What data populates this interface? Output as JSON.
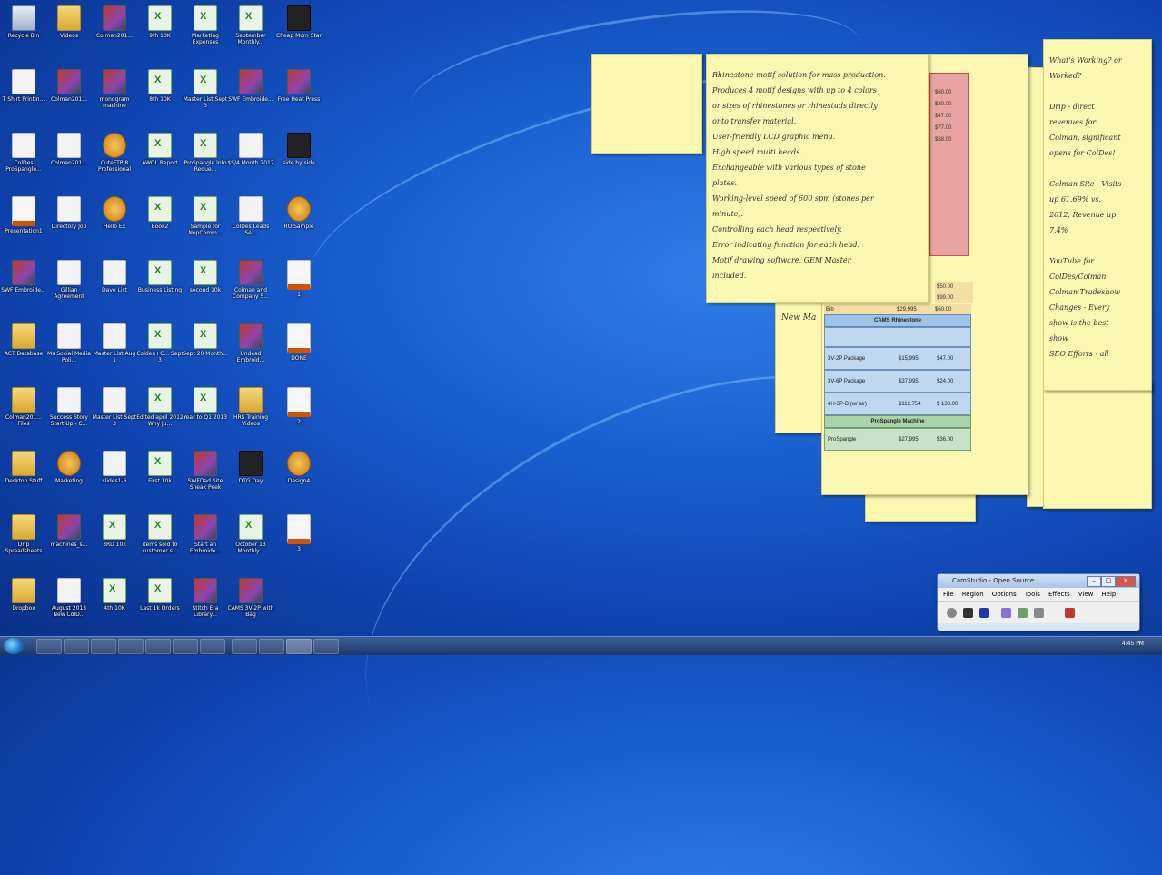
{
  "desktop_icons": [
    {
      "label": "Recycle Bin",
      "icon": "recycle-bin-icon"
    },
    {
      "label": "Videos",
      "icon": "folder-icon"
    },
    {
      "label": "Colman201...",
      "icon": "image-icon"
    },
    {
      "label": "9th 10K",
      "icon": "spreadsheet-icon"
    },
    {
      "label": "Marketing Expenses",
      "icon": "spreadsheet-icon"
    },
    {
      "label": "September Monthly...",
      "icon": "spreadsheet-icon"
    },
    {
      "label": "Cheap Mom Star",
      "icon": "video-icon"
    },
    {
      "label": "T Shirt Printin...",
      "icon": "document-icon"
    },
    {
      "label": "Colman201...",
      "icon": "image-icon"
    },
    {
      "label": "monogram machine",
      "icon": "image-icon"
    },
    {
      "label": "8th 10K",
      "icon": "spreadsheet-icon"
    },
    {
      "label": "Master List Sept 3",
      "icon": "spreadsheet-icon"
    },
    {
      "label": "SWF Embroide...",
      "icon": "image-icon"
    },
    {
      "label": "Free Heat Press",
      "icon": "image-icon"
    },
    {
      "label": "ColDes ProSpangle...",
      "icon": "document-icon"
    },
    {
      "label": "Colman201...",
      "icon": "document-icon"
    },
    {
      "label": "CuteFTP 8 Professional",
      "icon": "app-icon"
    },
    {
      "label": "AWOL Report",
      "icon": "spreadsheet-icon"
    },
    {
      "label": "ProSpangle Info Reque...",
      "icon": "spreadsheet-icon"
    },
    {
      "label": "$S/4 Month 2012",
      "icon": "document-icon"
    },
    {
      "label": "side by side",
      "icon": "video-icon"
    },
    {
      "label": "Presentation1",
      "icon": "presentation-icon"
    },
    {
      "label": "Directory Job",
      "icon": "document-icon"
    },
    {
      "label": "Hello Ex",
      "icon": "app-icon"
    },
    {
      "label": "Book2",
      "icon": "spreadsheet-icon"
    },
    {
      "label": "Sample for NopComm...",
      "icon": "spreadsheet-icon"
    },
    {
      "label": "ColDes Leads Se...",
      "icon": "document-icon"
    },
    {
      "label": "ROISample",
      "icon": "app-icon"
    },
    {
      "label": "SWF Embroide...",
      "icon": "image-icon"
    },
    {
      "label": "Gillian Agreement",
      "icon": "document-icon"
    },
    {
      "label": "Dave List",
      "icon": "document-icon"
    },
    {
      "label": "Business Listing",
      "icon": "spreadsheet-icon"
    },
    {
      "label": "second 10k",
      "icon": "spreadsheet-icon"
    },
    {
      "label": "Colman and Company 5...",
      "icon": "image-icon"
    },
    {
      "label": "1",
      "icon": "presentation-icon"
    },
    {
      "label": "ACT Database",
      "icon": "folder-icon"
    },
    {
      "label": "Ms Social Media Poli...",
      "icon": "document-icon"
    },
    {
      "label": "Master List Aug 1",
      "icon": "document-icon"
    },
    {
      "label": "Colden+C... Sept 3",
      "icon": "spreadsheet-icon"
    },
    {
      "label": "Sept 20 Month...",
      "icon": "spreadsheet-icon"
    },
    {
      "label": "Undead Embroid...",
      "icon": "image-icon"
    },
    {
      "label": "DONE",
      "icon": "presentation-icon"
    },
    {
      "label": "Colman201... Files",
      "icon": "folder-icon"
    },
    {
      "label": "Success Story Start Up - C...",
      "icon": "document-icon"
    },
    {
      "label": "Master List Sept 3",
      "icon": "document-icon"
    },
    {
      "label": "Edited april 2012 Why Ju...",
      "icon": "spreadsheet-icon"
    },
    {
      "label": "Year to Q1 2013",
      "icon": "spreadsheet-icon"
    },
    {
      "label": "HRS Training Videos",
      "icon": "folder-icon"
    },
    {
      "label": "2",
      "icon": "presentation-icon"
    },
    {
      "label": "Desktop Stuff",
      "icon": "folder-icon"
    },
    {
      "label": "Marketing",
      "icon": "app-icon"
    },
    {
      "label": "slides1-6",
      "icon": "document-icon"
    },
    {
      "label": "First 10k",
      "icon": "spreadsheet-icon"
    },
    {
      "label": "SWFDad Site Sneak Peek",
      "icon": "image-icon"
    },
    {
      "label": "DTG Day",
      "icon": "video-icon"
    },
    {
      "label": "Design4",
      "icon": "app-icon"
    },
    {
      "label": "Drip Spreadsheets",
      "icon": "folder-icon"
    },
    {
      "label": "machines_s...",
      "icon": "image-icon"
    },
    {
      "label": "3RD 10k",
      "icon": "spreadsheet-icon"
    },
    {
      "label": "items sold to customer s...",
      "icon": "spreadsheet-icon"
    },
    {
      "label": "Start an Embroide...",
      "icon": "image-icon"
    },
    {
      "label": "October 13 Monthly...",
      "icon": "spreadsheet-icon"
    },
    {
      "label": "3",
      "icon": "presentation-icon"
    },
    {
      "label": "Dropbox",
      "icon": "folder-icon"
    },
    {
      "label": "August 2013 New CoID...",
      "icon": "document-icon"
    },
    {
      "label": "4th 10K",
      "icon": "spreadsheet-icon"
    },
    {
      "label": "Last 1k Orders",
      "icon": "spreadsheet-icon"
    },
    {
      "label": "Stitch Era Library...",
      "icon": "image-icon"
    },
    {
      "label": "CAMS 3V-2P with Bag",
      "icon": "image-icon"
    }
  ],
  "notes": {
    "rhinestone": {
      "text": "Rhinestone motif solution for mass production.\nProduces 4 motif designs with up to 4 colors\nor sizes of rhinestones or rhinestuds directly\nonto transfer material.\nUser-friendly LCD graphic menu.\nHigh speed multi heads.\nExchangeable with various types of stone\nplates.\nWorking-level speed of 600 spm (stones per\nminute).\nControlling each head respectively.\nError indicating function for each head.\nMotif drawing software, GEM Master\nincluded."
    },
    "working": {
      "text": "What's Working? or\nWorked?\n\nDrip - direct\nrevenues for\nColman, significant\nopens for ColDes!\n\nColman Site - Visits\nup 61.69% vs.\n2012, Revenue up\n7.4%\n\nYouTube for\nColDes/Colman\nColman Tradeshow\nChanges - Every\nshow is the best\nshow\nSEO Efforts - all"
    },
    "partial_new": {
      "text": "New Ma"
    }
  },
  "price_sheet": {
    "headers": {
      "cams": "CAMS Rhinestone",
      "prospangle": "ProSpangle Machine"
    },
    "row_top": {
      "name": "Bib",
      "price": "$29,995",
      "extra": "$60.00"
    },
    "rows": [
      {
        "name": "3V-2P Package",
        "price": "$15,995",
        "extra": "$47.00"
      },
      {
        "name": "3V-6P Package",
        "price": "$37,995",
        "extra": "$24.00"
      },
      {
        "name": "4H-3P-B (w/ air)",
        "price": "$112,754",
        "extra": "$ 138.00"
      }
    ],
    "prospangle_row": {
      "name": "ProSpangle",
      "price": "$27,995",
      "extra": "$36.00"
    },
    "mini_values": [
      "$60.00",
      "$80.00",
      "$47.00",
      "$77.00",
      "$88.00"
    ],
    "side_values": [
      "$50.00",
      "$99.00"
    ]
  },
  "camstudio": {
    "title": "CamStudio - Open Source",
    "menu": [
      "File",
      "Region",
      "Options",
      "Tools",
      "Effects",
      "View",
      "Help"
    ]
  },
  "taskbar": {
    "clock": "4:45 PM"
  }
}
